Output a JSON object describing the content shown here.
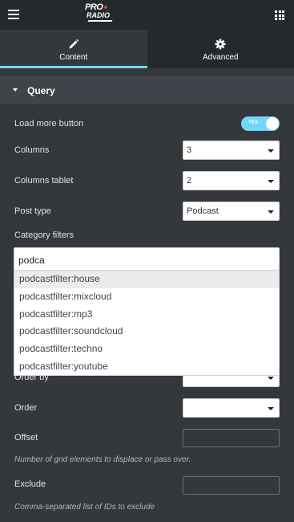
{
  "topbar": {
    "logo_top": "PRO",
    "logo_bottom": "RADIO"
  },
  "tabs": [
    {
      "label": "Content",
      "icon": "pencil-icon",
      "active": true
    },
    {
      "label": "Advanced",
      "icon": "gear-icon",
      "active": false
    }
  ],
  "section": {
    "title": "Query"
  },
  "controls": {
    "load_more": {
      "label": "Load more button",
      "toggle_text": "YES",
      "on": true
    },
    "columns": {
      "label": "Columns",
      "value": "3"
    },
    "columns_tablet": {
      "label": "Columns tablet",
      "value": "2"
    },
    "post_type": {
      "label": "Post type",
      "value": "Podcast"
    },
    "category_filters": {
      "label": "Category filters",
      "typed": "podca",
      "options": [
        "podcastfilter:house",
        "podcastfilter:mixcloud",
        "podcastfilter:mp3",
        "podcastfilter:soundcloud",
        "podcastfilter:techno",
        "podcastfilter:youtube"
      ]
    },
    "order_by": {
      "label": "Order by",
      "value": ""
    },
    "order": {
      "label": "Order",
      "value": ""
    },
    "offset": {
      "label": "Offset",
      "value": "",
      "description": "Number of grid elements to displace or pass over."
    },
    "exclude": {
      "label": "Exclude",
      "value": "",
      "description": "Comma-separated list of IDs to exclude"
    }
  },
  "colors": {
    "accent": "#71d7f7",
    "panel": "#34383c",
    "topbar": "#26292c",
    "section_header": "#404349"
  }
}
